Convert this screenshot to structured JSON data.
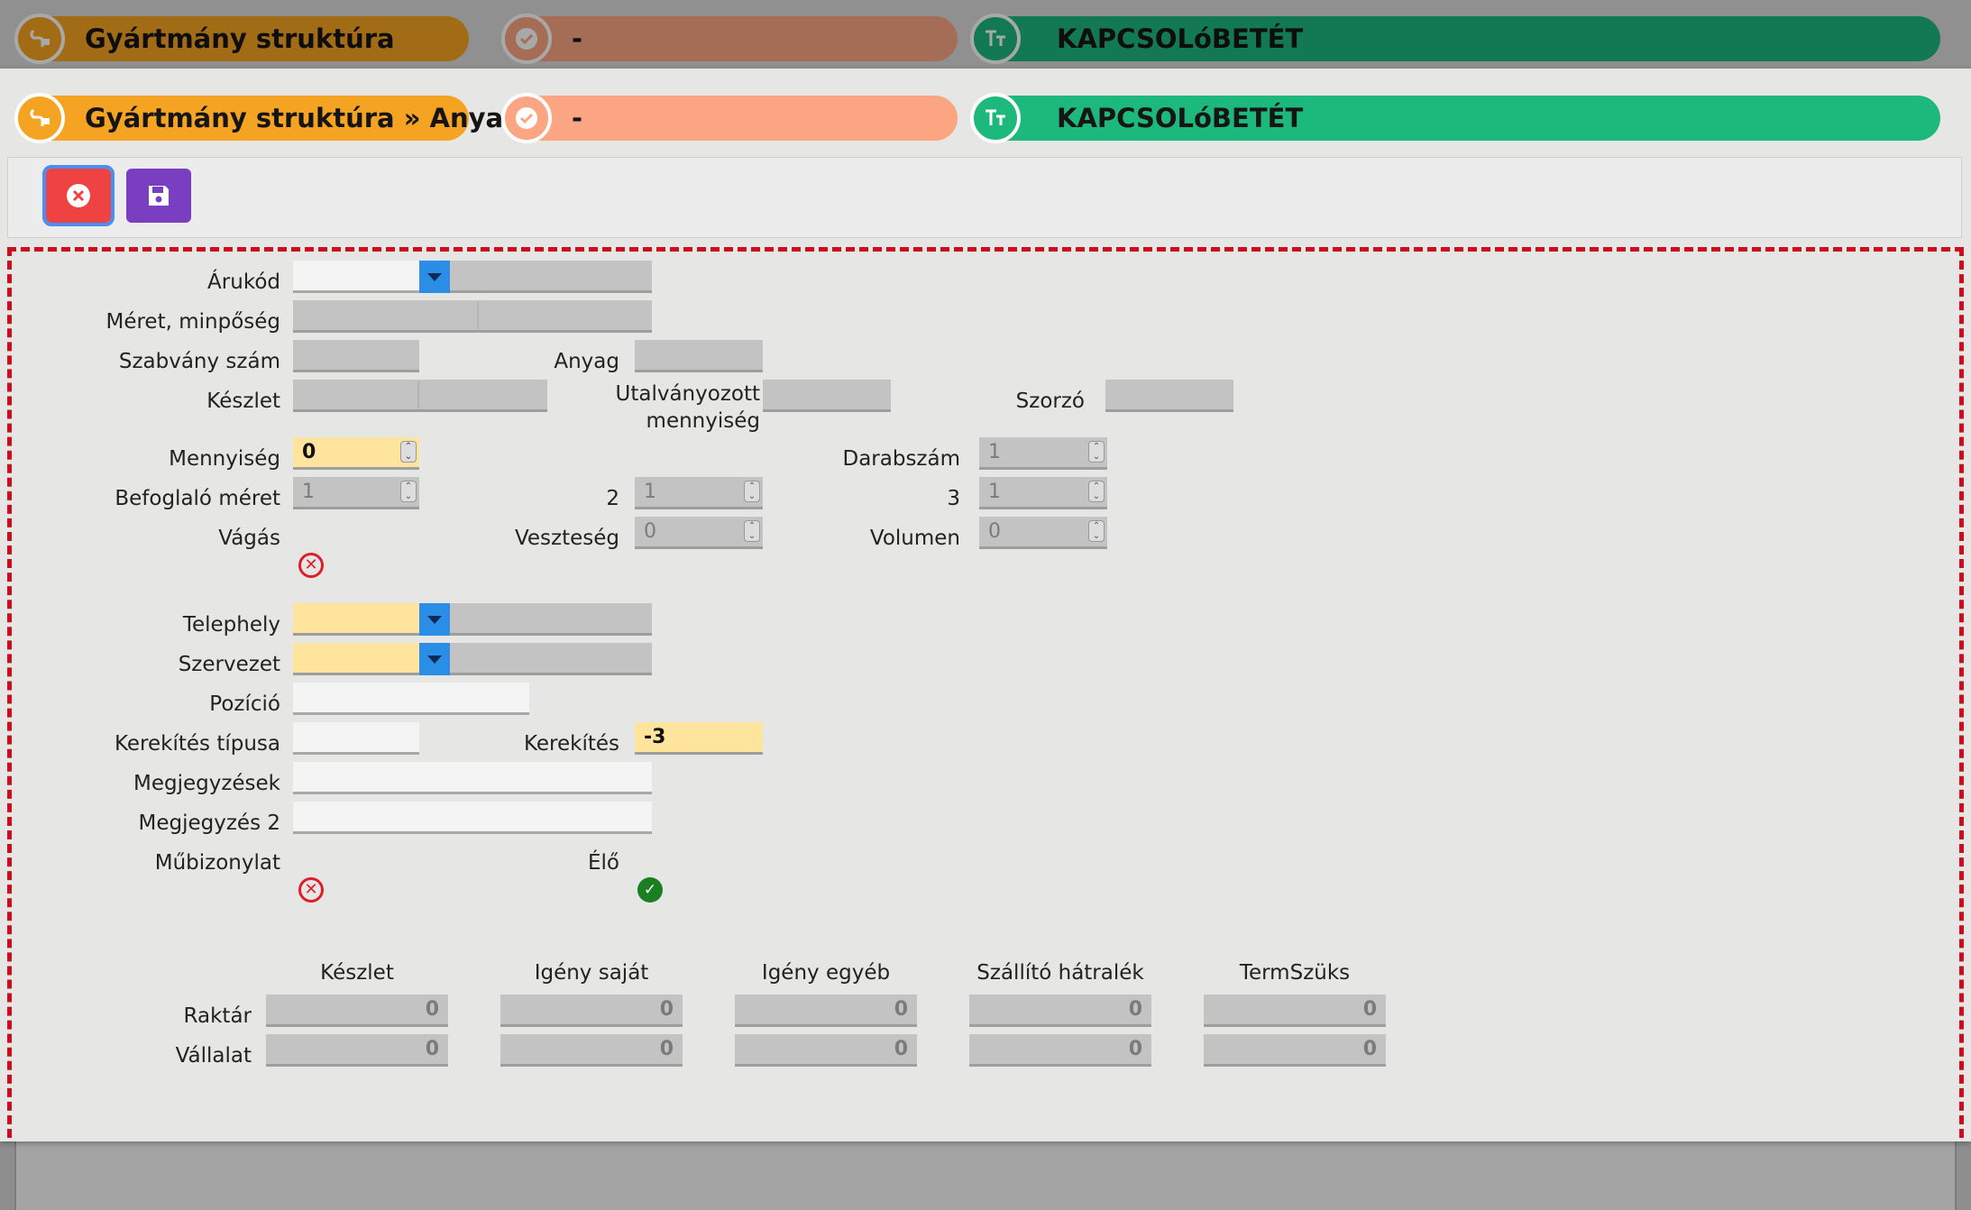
{
  "header_back": {
    "module_label": "Gyártmány struktúra",
    "status_label": "-",
    "name_label": "KAPCSOLóBETÉT"
  },
  "header": {
    "module_label": "Gyártmány struktúra » Anyag",
    "status_label": "-",
    "name_label": "KAPCSOLóBETÉT"
  },
  "icons": {
    "module": "plug-icon",
    "status": "check-badge-icon",
    "name": "text-size-icon",
    "cancel": "close-circle-icon",
    "save": "floppy-disk-icon"
  },
  "colors": {
    "module": "#f5a322",
    "status": "#fca582",
    "name": "#1db87c",
    "cancel": "#ef4242",
    "save": "#7a3fc0",
    "required": "#ffe49e",
    "dropdown": "#2a8ee6",
    "form_border": "#cc0d1f"
  },
  "form": {
    "arukod_label": "Árukód",
    "meret_label": "Méret, minpőség",
    "szabvany_label": "Szabvány szám",
    "anyag_label": "Anyag",
    "keszlet_label": "Készlet",
    "utalvanyozott_label_1": "Utalványozott",
    "utalvanyozott_label_2": "mennyiség",
    "szorzo_label": "Szorzó",
    "mennyiseg_label": "Mennyiség",
    "mennyiseg_value": "0",
    "darabszam_label": "Darabszám",
    "darabszam_value": "1",
    "befoglalo_label": "Befoglaló méret",
    "befoglalo_value": "1",
    "dim2_label": "2",
    "dim2_value": "1",
    "dim3_label": "3",
    "dim3_value": "1",
    "vagas_label": "Vágás",
    "vagas_value": false,
    "veszteseg_label": "Veszteség",
    "veszteseg_value": "0",
    "volumen_label": "Volumen",
    "volumen_value": "0",
    "telephely_label": "Telephely",
    "szervezet_label": "Szervezet",
    "pozicio_label": "Pozíció",
    "kerekites_tipusa_label": "Kerekítés típusa",
    "kerekites_label": "Kerekítés",
    "kerekites_value": "-3",
    "megjegyzesek_label": "Megjegyzések",
    "megjegyzes2_label": "Megjegyzés 2",
    "mubizonylat_label": "Műbizonylat",
    "mubizonylat_value": false,
    "elo_label": "Élő",
    "elo_value": true
  },
  "stock": {
    "columns": [
      "Készlet",
      "Igény saját",
      "Igény egyéb",
      "Szállító hátralék",
      "TermSzüks"
    ],
    "rows": [
      {
        "label": "Raktár",
        "values": [
          "0",
          "0",
          "0",
          "0",
          "0"
        ]
      },
      {
        "label": "Vállalat",
        "values": [
          "0",
          "0",
          "0",
          "0",
          "0"
        ]
      }
    ]
  }
}
